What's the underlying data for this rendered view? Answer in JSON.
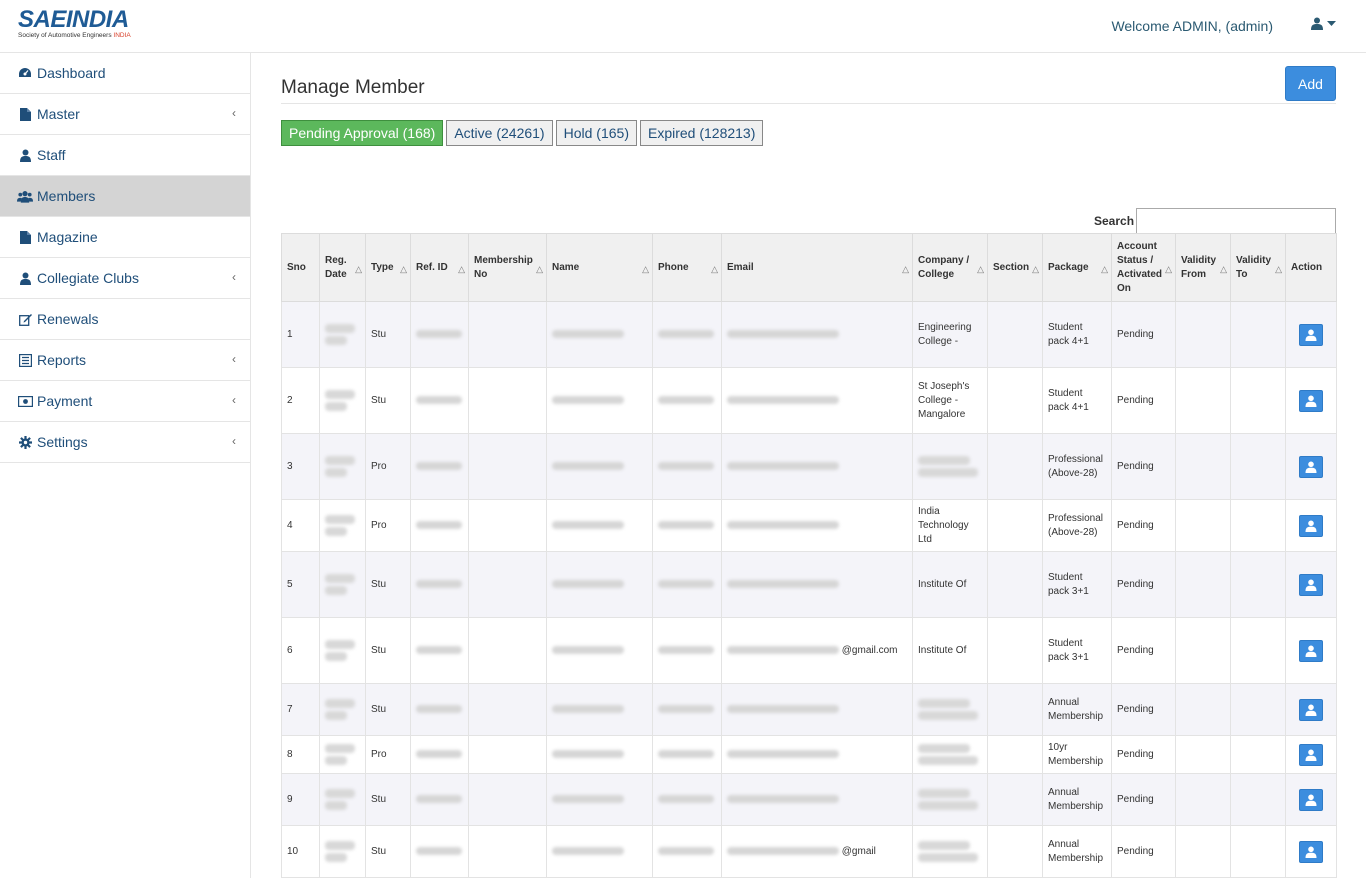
{
  "brand": {
    "logo_main": "SAEINDIA",
    "logo_sub_a": "Society of Automotive Engineers ",
    "logo_sub_b": "INDIA"
  },
  "header": {
    "welcome": "Welcome ADMIN, (admin)"
  },
  "sidebar": {
    "items": [
      {
        "label": "Dashboard",
        "icon": "dashboard-icon",
        "chevron": false,
        "active": false
      },
      {
        "label": "Master",
        "icon": "file-icon",
        "chevron": true,
        "active": false
      },
      {
        "label": "Staff",
        "icon": "user-icon",
        "chevron": false,
        "active": false
      },
      {
        "label": "Members",
        "icon": "users-icon",
        "chevron": false,
        "active": true
      },
      {
        "label": "Magazine",
        "icon": "file-icon",
        "chevron": false,
        "active": false
      },
      {
        "label": "Collegiate Clubs",
        "icon": "user-icon",
        "chevron": true,
        "active": false
      },
      {
        "label": "Renewals",
        "icon": "edit-icon",
        "chevron": false,
        "active": false
      },
      {
        "label": "Reports",
        "icon": "list-icon",
        "chevron": true,
        "active": false
      },
      {
        "label": "Payment",
        "icon": "money-icon",
        "chevron": true,
        "active": false
      },
      {
        "label": "Settings",
        "icon": "gear-icon",
        "chevron": true,
        "active": false
      }
    ]
  },
  "main": {
    "title": "Manage Member",
    "add_label": "Add",
    "tabs": [
      {
        "label": "Pending Approval (168)",
        "active": true
      },
      {
        "label": "Active (24261)",
        "active": false
      },
      {
        "label": "Hold (165)",
        "active": false
      },
      {
        "label": "Expired (128213)",
        "active": false
      }
    ],
    "search_label": "Search",
    "search_value": ""
  },
  "table": {
    "headers": [
      "Sno",
      "Reg. Date",
      "Type",
      "Ref. ID",
      "Membership No",
      "Name",
      "Phone",
      "Email",
      "Company / College",
      "Section",
      "Package",
      "Account Status / Activated On",
      "Validity From",
      "Validity To",
      "Action"
    ],
    "rows": [
      {
        "sno": "1",
        "type": "Stu",
        "package": "Student pack 4+1",
        "status": "Pending",
        "name_text": "",
        "phone_text": "",
        "email_text": "",
        "company_text": "Engineering College -"
      },
      {
        "sno": "2",
        "type": "Stu",
        "package": "Student pack 4+1",
        "status": "Pending",
        "name_text": "",
        "phone_text": "",
        "email_text": "",
        "company_text": "St Joseph's College - Mangalore"
      },
      {
        "sno": "3",
        "type": "Pro",
        "package": "Professional (Above-28)",
        "status": "Pending",
        "name_text": "",
        "phone_text": "",
        "email_text": "",
        "company_text": ""
      },
      {
        "sno": "4",
        "type": "Pro",
        "package": "Professional (Above-28)",
        "status": "Pending",
        "name_text": "",
        "phone_text": "",
        "email_text": "",
        "company_text": "India Technology Ltd"
      },
      {
        "sno": "5",
        "type": "Stu",
        "package": "Student pack 3+1",
        "status": "Pending",
        "name_text": "",
        "phone_text": "",
        "email_text": "",
        "company_text": "Institute Of"
      },
      {
        "sno": "6",
        "type": "Stu",
        "package": "Student pack 3+1",
        "status": "Pending",
        "name_text": "",
        "phone_text": "",
        "email_text": "@gmail.com",
        "company_text": "Institute Of"
      },
      {
        "sno": "7",
        "type": "Stu",
        "package": "Annual Membership",
        "status": "Pending",
        "name_text": "",
        "phone_text": "",
        "email_text": "",
        "company_text": ""
      },
      {
        "sno": "8",
        "type": "Pro",
        "package": "10yr Membership",
        "status": "Pending",
        "name_text": "",
        "phone_text": "",
        "email_text": "",
        "company_text": ""
      },
      {
        "sno": "9",
        "type": "Stu",
        "package": "Annual Membership",
        "status": "Pending",
        "name_text": "",
        "phone_text": "",
        "email_text": "",
        "company_text": ""
      },
      {
        "sno": "10",
        "type": "Stu",
        "package": "Annual Membership",
        "status": "Pending",
        "name_text": "",
        "phone_text": "",
        "email_text": "@gmail",
        "company_text": ""
      }
    ]
  },
  "colors": {
    "accent": "#3c8dde",
    "active_tab": "#5cb85c",
    "nav_text": "#1f4e79"
  }
}
